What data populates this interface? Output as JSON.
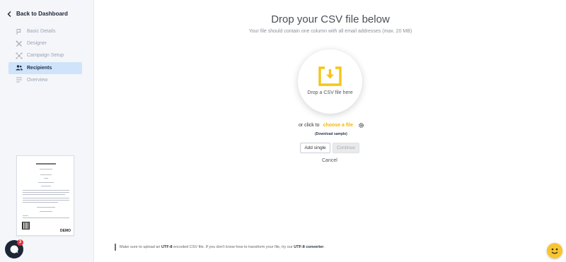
{
  "sidebar": {
    "back_label": "Back to Dashboard",
    "items": [
      {
        "label": "Basic Details",
        "icon": "flag-icon",
        "active": false
      },
      {
        "label": "Designer",
        "icon": "tools-icon",
        "active": false
      },
      {
        "label": "Campaign Setup",
        "icon": "network-icon",
        "active": false
      },
      {
        "label": "Recipients",
        "icon": "users-icon",
        "active": true
      },
      {
        "label": "Overview",
        "icon": "list-icon",
        "active": false
      }
    ],
    "preview_badge": "DEMO",
    "chat_badge_count": "3"
  },
  "main": {
    "title": "Drop your CSV file below",
    "subtitle": "Your file should contain one column with all email addresses (max. 20 MB)",
    "drop_label": "Drop a CSV file here",
    "or_click_to": "or click to",
    "choose_file": "choose a file",
    "download_sample": "(Download sample)",
    "add_single": "Add single",
    "continue": "Continue",
    "cancel": "Cancel",
    "note": {
      "part1": "Make sure to upload an ",
      "utf8": "UTF-8",
      "part2": " encoded CSV file. If you don't know how to transform your file, try our ",
      "converter": "UTF-8 converter",
      "part3": "."
    }
  },
  "colors": {
    "accent": "#f2b707",
    "active_nav_bg": "#cfe3fa",
    "sidebar_bg": "#f4f6fa",
    "chat_bg": "#1e2736",
    "badge": "#e0333c"
  }
}
